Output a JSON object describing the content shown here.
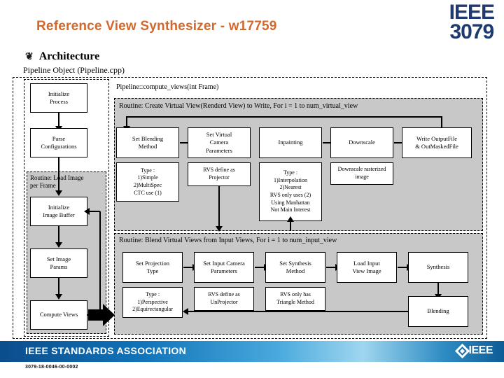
{
  "header": {
    "title": "Reference View Synthesizer - w17759",
    "logo_line1": "IEEE",
    "logo_line2": "3079",
    "section_bullet": "❦",
    "section_title": "Architecture",
    "subtitle": "Pipeline Object (Pipeline.cpp)"
  },
  "diagram": {
    "compute_views_label": "Pipeline::compute_views(int Frame)",
    "left_flow": [
      {
        "label": "Initialize\nProcess"
      },
      {
        "label": "Parse\nConfigurations"
      },
      {
        "label": "Initialize\nImage Buffer"
      },
      {
        "label": "Set Image\nParams"
      },
      {
        "label": "Compute Views"
      }
    ],
    "load_routine_label": "Routine: Load Image\nper Frame",
    "virtual_routine_label": "Routine: Create Virtual View(Renderd View) to Write,  For i = 1 to num_virtual_view",
    "virtual_steps": [
      {
        "label": "Set Blending\nMethod",
        "note": "Type :\n1)Simple\n2)MultiSpec\nCTC use (1)"
      },
      {
        "label": "Set Virtual\nCamera\nParameters",
        "note": "RVS define as\nProjector"
      },
      {
        "label": "Inpainting",
        "note": "Type :\n1)Interpolation\n2)Nearest\nRVS only uses (2)\nUsing Manhattan\nNot Main Interest"
      },
      {
        "label": "Downscale",
        "note": "Downscale rasterized\nimage"
      },
      {
        "label": "Write OutputFile\n& OutMaskedFile",
        "note": ""
      }
    ],
    "blend_routine_label": "Routine: Blend Virtual Views from Input Views,  For i = 1 to num_input_view",
    "blend_steps": [
      {
        "label": "Set Projection\nType",
        "note": "Type :\n1)Perspective\n2)Equirectangular"
      },
      {
        "label": "Set Input Camera\nParameters",
        "note": "RVS define as\nUnProjector"
      },
      {
        "label": "Set Synthesis\nMethod",
        "note": "RVS only has\nTriangle Method"
      },
      {
        "label": "Load Input\nView Image",
        "note": ""
      },
      {
        "label": "Synthesis",
        "note": ""
      }
    ],
    "blending_box": "Blending"
  },
  "footer": {
    "association": "IEEE STANDARDS ASSOCIATION",
    "brand": "IEEE",
    "doc_number": "3079-18-0046-00-0002"
  },
  "colors": {
    "title": "#D2682C",
    "logo": "#1F3A70",
    "routine_gray": "#C8C8C8",
    "footer_blue": "#1173B8"
  }
}
